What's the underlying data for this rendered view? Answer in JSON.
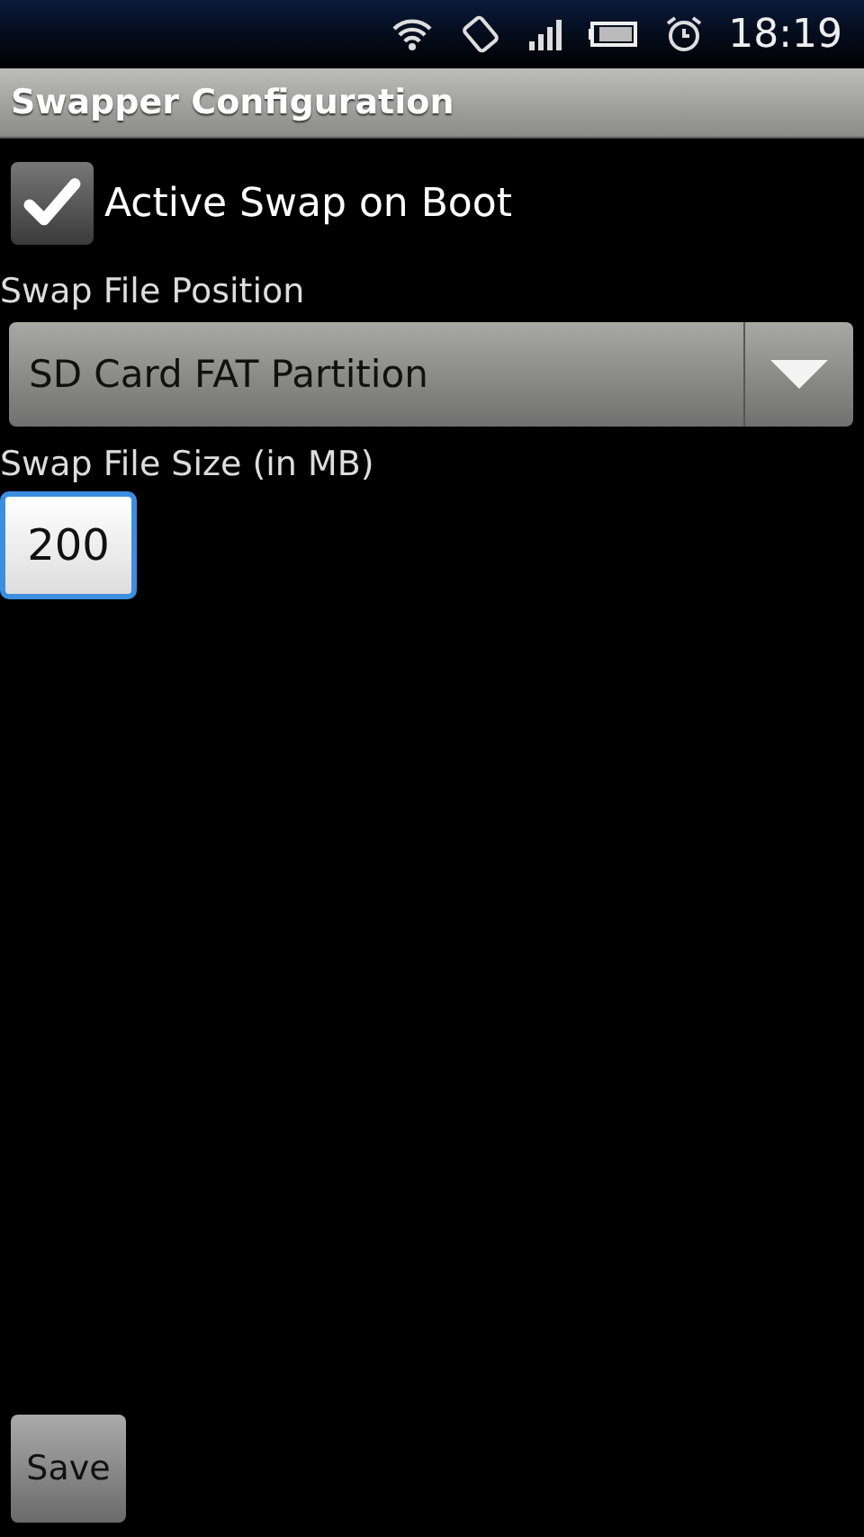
{
  "status_bar": {
    "time": "18:19"
  },
  "title_bar": {
    "title": "Swapper Configuration"
  },
  "checkbox": {
    "label": "Active Swap on Boot",
    "checked": true
  },
  "position": {
    "label": "Swap File Position",
    "value": "SD Card FAT Partition"
  },
  "size": {
    "label": "Swap File Size (in MB)",
    "value": "200",
    "focused": true
  },
  "buttons": [
    "Save"
  ]
}
